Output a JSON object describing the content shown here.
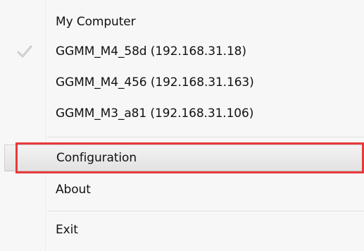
{
  "menu": {
    "items": [
      {
        "label": "My Computer",
        "checked": false
      },
      {
        "label": "GGMM_M4_58d (192.168.31.18)",
        "checked": true
      },
      {
        "label": "GGMM_M4_456 (192.168.31.163)",
        "checked": false
      },
      {
        "label": "GGMM_M3_a81 (192.168.31.106)",
        "checked": false
      }
    ],
    "configuration": {
      "label": "Configuration"
    },
    "about": {
      "label": "About"
    },
    "exit": {
      "label": "Exit"
    }
  },
  "colors": {
    "highlight_border": "#e83a3a",
    "check_mark": "#b8b8b8"
  }
}
